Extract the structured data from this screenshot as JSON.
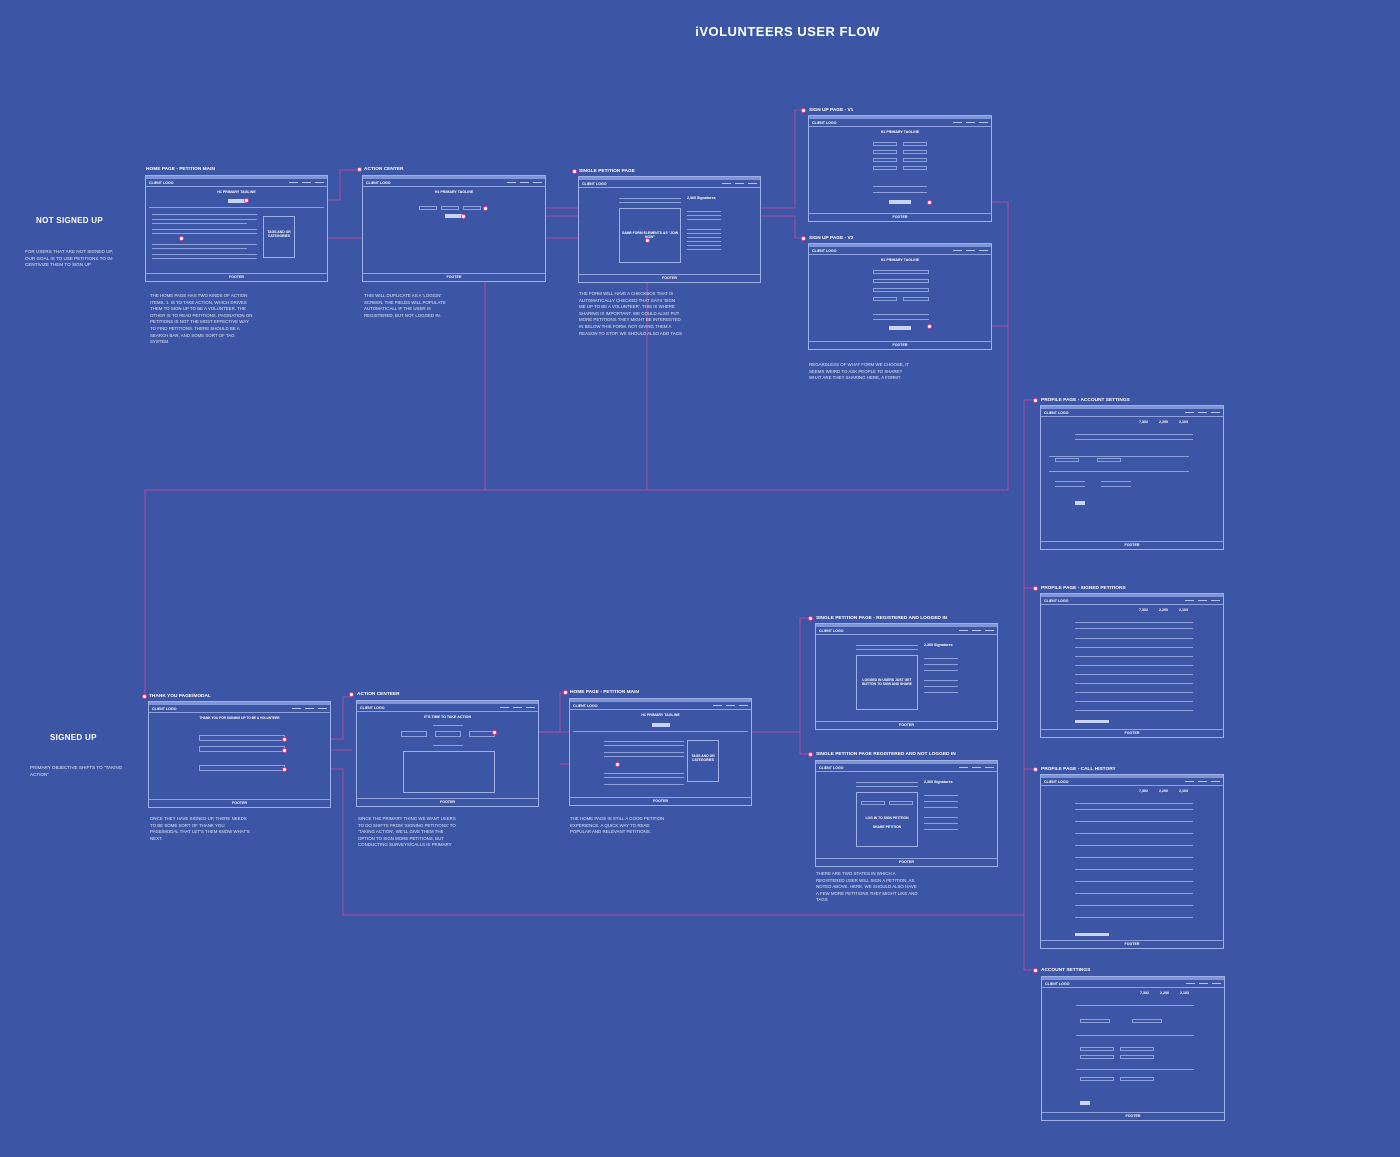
{
  "title": "iVOLUNTEERS USER FLOW",
  "sections": {
    "not_signed_up": "NOT SIGNED UP",
    "not_signed_up_note": "FOR USERS THAT ARE NOT SIGNED UP, OUR GOAL IS TO USE PETITIONS TO IN-CENTIVIZE THEM TO SIGN UP",
    "signed_up": "SIGNED UP",
    "signed_up_note": "PRIMARY OBJECTIVE SHIFTS TO \"TAKING ACTION\""
  },
  "common": {
    "client_logo": "CLIENT LOGO",
    "footer": "FOOTER",
    "primary_tagline": "H1 PRIMARY TAGLINE",
    "tags": "TAGS AND OR CATEGORIES",
    "signatures": "2,365 Signatures",
    "same_form": "SAME FORM ELEMENTS AS \"JOIN NOW\"",
    "logged_in_users": "LOGGED IN USERS JUST GET BUTTON TO SIGN AND SHARE",
    "login_to_sign": "LOG IN TO SIGN PETITION",
    "share_petition": "SHARE PETITION",
    "thank_you": "THANK YOU FOR SIGNING UP TO BE A VOLUNTEER",
    "time_to_act": "IT'S TIME TO TAKE ACTION",
    "stats": [
      "7,302",
      "2,200",
      "2,103"
    ]
  },
  "screens": {
    "home_main": {
      "label": "HOME PAGE - PETITION MAIN",
      "note": "THE HOME PAGE HAS TWO KINDS OF ACTION ITEMS. 1. IS TO TAKE ACTION, WHICH DRIVES THEM TO SIGN UP TO BE A VOLUNTEER. THE OTHER IS TO READ PETITIONS. PAGINATION ON PETITIONS IS NOT THE MOST EFFECTIVE WAY TO FIND PETITIONS. THERE SHOULD BE A SEARCH BAR, AND SOME SORT OF TAG SYSTEM."
    },
    "action_center": {
      "label": "ACTION CENTER",
      "note": "THIS WILL DUPLICATE AS A 'LOGGIN' SCREEN. THE FIELDS WILL POPULATE AUTOMATICALL IF THE USER IS REGISTERED, BUT NOT LOGGED IN."
    },
    "single_petition": {
      "label": "SINGLE PETITION PAGE",
      "note": "THE FORM WILL HAVE A CHECKBOX THAT IS AUTOMATICALLY CHECKED THAT SAYS 'SIGN ME UP TO BE A VOLUNTEER'. THIS IS WHERE SHARING IS IMPORTANT. WE COULD ALSO PUT MORE PETITIONS THEY MIGHT BE INTERESTED IN BELOW THIS FORM. NOT GIVING THEM A REASON TO STOP.  WE SHOULD ALSO ADD TAGS"
    },
    "sign_up_v1": {
      "label": "SIGN UP PAGE - V1"
    },
    "sign_up_v2": {
      "label": "SIGN UP PAGE - V2",
      "note": "REGARDLESS OF WHAT FORM WE CHOOSE, IT SEEMS WEIRD TO ASK PEOPLE TO SHARE? WHAT ARE THEY SHARING HERE, A FORM?"
    },
    "profile_account": {
      "label": "PROFILE PAGE - ACCOUNT SETTINGS"
    },
    "profile_signed": {
      "label": "PROFILE PAGE - SIGNED PETITIONS"
    },
    "profile_calls": {
      "label": "PROFILE PAGE - CALL HISTORY"
    },
    "account_settings": {
      "label": "ACCOUNT SETTINGS"
    },
    "single_logged_in": {
      "label": "SINGLE PETITION PAGE - REGISTERED AND LOGGED IN"
    },
    "single_not_logged": {
      "label": "SINGLE PETITION PAGE REGISTERED AND NOT LOGGED IN",
      "note": "THERE ARE TWO STATES IN WHICH A REGISTERED USER WILL SIGN A PETITION, AS NOTED ABOVE. HERE, WE SHOULD ALSO HAVE A FEW MORE PETITIONS THEY MIGHT LIKE AND TAGS"
    },
    "thank_you": {
      "label": "THANK YOU PAGE/MODAL",
      "note": "ONCE THEY HAVE SIGNED UP, THERE NEEDS TO BE SOME SORT OF THANK YOU PAGE/MODAL THAT LET'S THEM KNOW WHAT'S NEXT."
    },
    "action_center_2": {
      "label": "ACTION CENTEER",
      "note": "SINCE THE PRIMARY THING WE WANT USERS TO DO SHIFTS FROM 'SIGNING PETITIONS' TO 'TAKING ACTION', WE'LL GIVE THEM THE OPTION TO SIGN MORE PETITIONS, BUT CONDUCTING SURVEYS/CALLS IS PRIMARY"
    },
    "home_main_2": {
      "label": "HOME PAGE - PETITION MAIN",
      "note": "THE HOME PAGE IS STILL A GOOD PETITION EXPERIENCE. A QUICK WAY TO READ POPULAR AND RELEVANT PETITIONS."
    }
  },
  "colors": {
    "background": "#3d55a5",
    "connector": "#e33b93",
    "frame": "#9fb0e6"
  }
}
